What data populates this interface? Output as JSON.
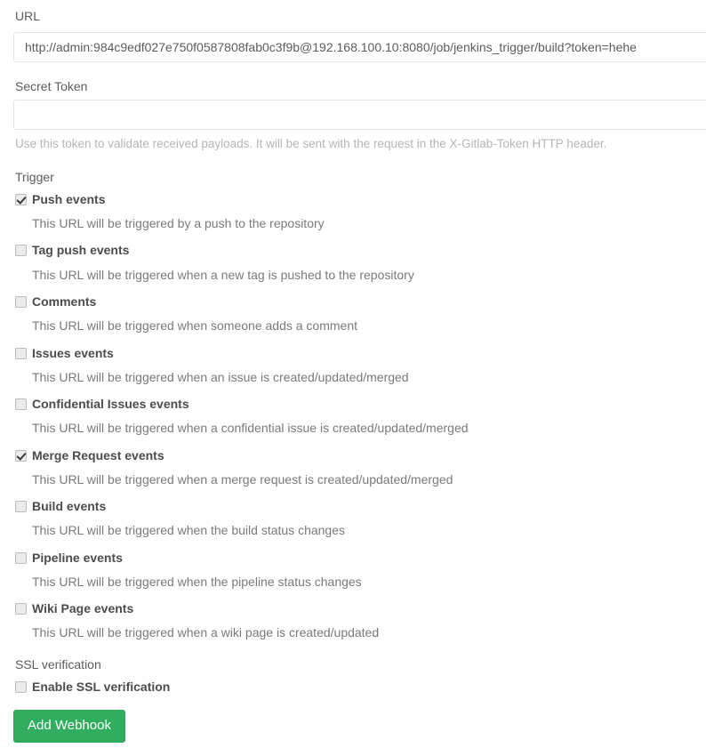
{
  "form": {
    "url_field": {
      "label": "URL",
      "value": "http://admin:984c9edf027e750f0587808fab0c3f9b@192.168.100.10:8080/job/jenkins_trigger/build?token=hehe",
      "placeholder": ""
    },
    "secret_token_field": {
      "label": "Secret Token",
      "value": "",
      "placeholder": "",
      "help": "Use this token to validate received payloads. It will be sent with the request in the X-Gitlab-Token HTTP header."
    },
    "trigger_section": {
      "heading": "Trigger",
      "items": [
        {
          "label": "Push events",
          "description": "This URL will be triggered by a push to the repository",
          "checked": true
        },
        {
          "label": "Tag push events",
          "description": "This URL will be triggered when a new tag is pushed to the repository",
          "checked": false
        },
        {
          "label": "Comments",
          "description": "This URL will be triggered when someone adds a comment",
          "checked": false
        },
        {
          "label": "Issues events",
          "description": "This URL will be triggered when an issue is created/updated/merged",
          "checked": false
        },
        {
          "label": "Confidential Issues events",
          "description": "This URL will be triggered when a confidential issue is created/updated/merged",
          "checked": false
        },
        {
          "label": "Merge Request events",
          "description": "This URL will be triggered when a merge request is created/updated/merged",
          "checked": true
        },
        {
          "label": "Build events",
          "description": "This URL will be triggered when the build status changes",
          "checked": false
        },
        {
          "label": "Pipeline events",
          "description": "This URL will be triggered when the pipeline status changes",
          "checked": false
        },
        {
          "label": "Wiki Page events",
          "description": "This URL will be triggered when a wiki page is created/updated",
          "checked": false
        }
      ]
    },
    "ssl_section": {
      "heading": "SSL verification",
      "checkbox": {
        "label": "Enable SSL verification",
        "checked": false
      }
    },
    "submit_button": {
      "label": "Add Webhook"
    }
  },
  "colors": {
    "accent_green": "#31ad60",
    "label_text": "#5c5c5c",
    "bold_label_text": "#4c4c4c",
    "description_text": "#7a7a7a",
    "help_text": "#b5b5b5",
    "input_border": "#e5e5e5",
    "checkbox_border": "#bcbcbc",
    "checkbox_fill": "#ebebeb"
  }
}
